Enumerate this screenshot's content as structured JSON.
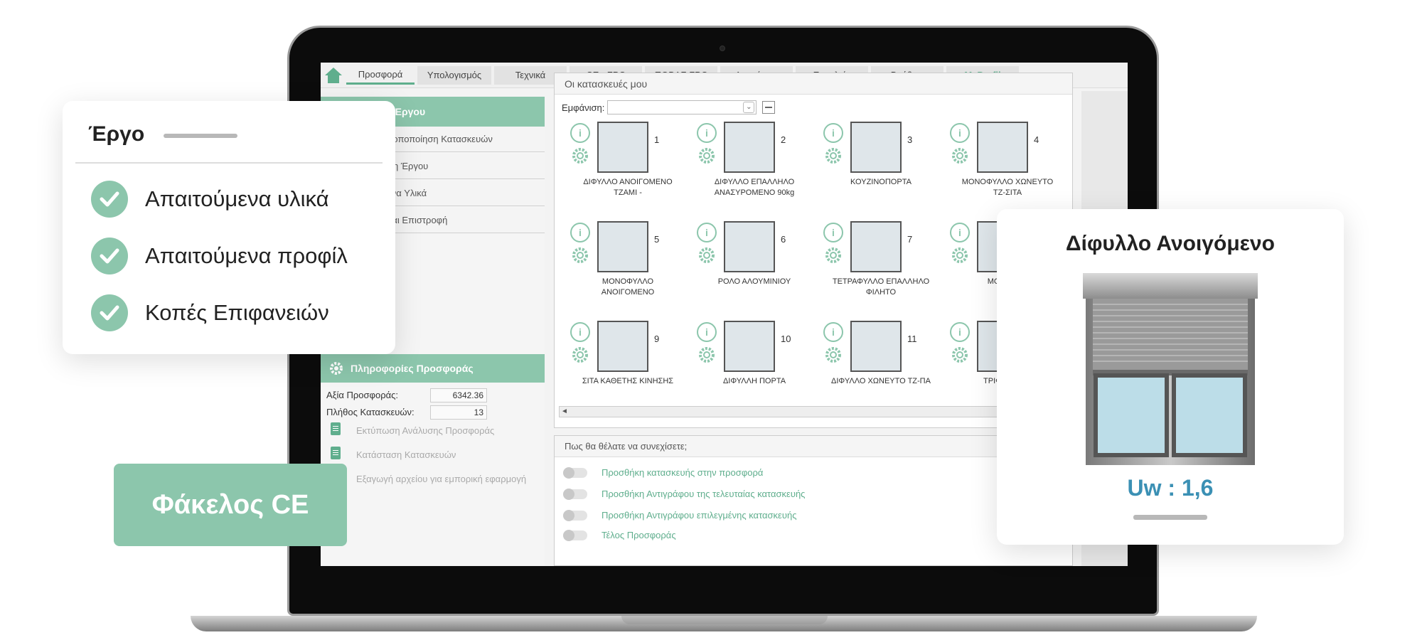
{
  "menubar": {
    "tabs": [
      "Προσφορά",
      "Υπολογισμός",
      "Τεχνικά",
      "CE - FPC",
      "ΠΟΒΑΣ FPC",
      "Διαχείριση",
      "Εργαλεία",
      "Βοήθεια",
      "MyProfil"
    ],
    "active_tab": "Προσφορά"
  },
  "left_panel": {
    "header": "Έργου",
    "items": [
      "ροποποίηση Κατασκευών",
      "ση Έργου",
      "ενα Υλικά",
      "και Επιστροφή"
    ],
    "info_header": "Πληροφορίες Προσφοράς",
    "offer_value_label": "Αξία Προσφοράς:",
    "offer_value": "6342.36",
    "constructions_count_label": "Πλήθος Κατασκευών:",
    "constructions_count": "13",
    "actions": [
      "Εκτύπωση Ανάλυσης Προσφοράς",
      "Κατάσταση Κατασκευών",
      "Εξαγωγή αρχείου για εμπορική εφαρμογή"
    ]
  },
  "constructions": {
    "title": "Οι κατασκευές μου",
    "show_label": "Εμφάνιση:",
    "items": [
      {
        "num": "1",
        "line1": "ΔΙΦΥΛΛΟ ΑΝΟΙΓΟΜΕΝΟ",
        "line2": "ΤΖΑΜΙ -"
      },
      {
        "num": "2",
        "line1": "ΔΙΦΥΛΛΟ ΕΠΑΛΛΗΛΟ",
        "line2": "ΑΝΑΣΥΡΟΜΕΝΟ 90kg"
      },
      {
        "num": "3",
        "line1": "ΚΟΥΖΙΝΟΠΟΡΤΑ",
        "line2": ""
      },
      {
        "num": "4",
        "line1": "ΜΟΝΟΦΥΛΛΟ ΧΩΝΕΥΤΟ",
        "line2": "ΤΖ-ΣΙΤΑ"
      },
      {
        "num": "5",
        "line1": "ΜΟΝΟΦΥΛΛΟ",
        "line2": "ΑΝΟΙΓΟΜΕΝΟ"
      },
      {
        "num": "6",
        "line1": "ΡΟΛΟ ΑΛΟΥΜΙΝΙΟΥ",
        "line2": ""
      },
      {
        "num": "7",
        "line1": "ΤΕΤΡΑΦΥΛΛΟ ΕΠΑΛΛΗΛΟ",
        "line2": "ΦΙΛΗΤΟ"
      },
      {
        "num": "",
        "line1": "ΜΟΝΟΦΥΛ",
        "line2": ""
      },
      {
        "num": "9",
        "line1": "ΣΙΤΑ ΚΑΘΕΤΗΣ ΚΙΝΗΣΗΣ",
        "line2": ""
      },
      {
        "num": "10",
        "line1": "ΔΙΦΥΛΛΗ ΠΟΡΤΑ",
        "line2": ""
      },
      {
        "num": "11",
        "line1": "ΔΙΦΥΛΛΟ ΧΩΝΕΥΤΟ ΤΖ-ΠΑ",
        "line2": ""
      },
      {
        "num": "",
        "line1": "ΤΡΙΦΥΛΛΟ ΑΙ",
        "line2": ""
      }
    ]
  },
  "continue": {
    "title": "Πως θα θέλατε να συνεχίσετε;",
    "options": [
      "Προσθήκη κατασκευής στην προσφορά",
      "Προσθήκη Αντιγράφου της τελευταίας κατασκευής",
      "Προσθήκη Αντιγράφου επιλεγμένης κατασκευής",
      "Τέλος Προσφοράς"
    ]
  },
  "ergo_card": {
    "title": "Έργο",
    "items": [
      "Απαιτούμενα  υλικά",
      "Απαιτούμενα  προφίλ",
      "Κοπές Επιφανειών"
    ]
  },
  "ce_card": {
    "label": "Φάκελος CE"
  },
  "product_card": {
    "title": "Δίφυλλο Ανοιγόμενο",
    "uw": "Uw : 1,6"
  },
  "colors": {
    "accent": "#8cc6ac",
    "accent_dark": "#5fae8d",
    "uw_blue": "#3b90b4"
  }
}
